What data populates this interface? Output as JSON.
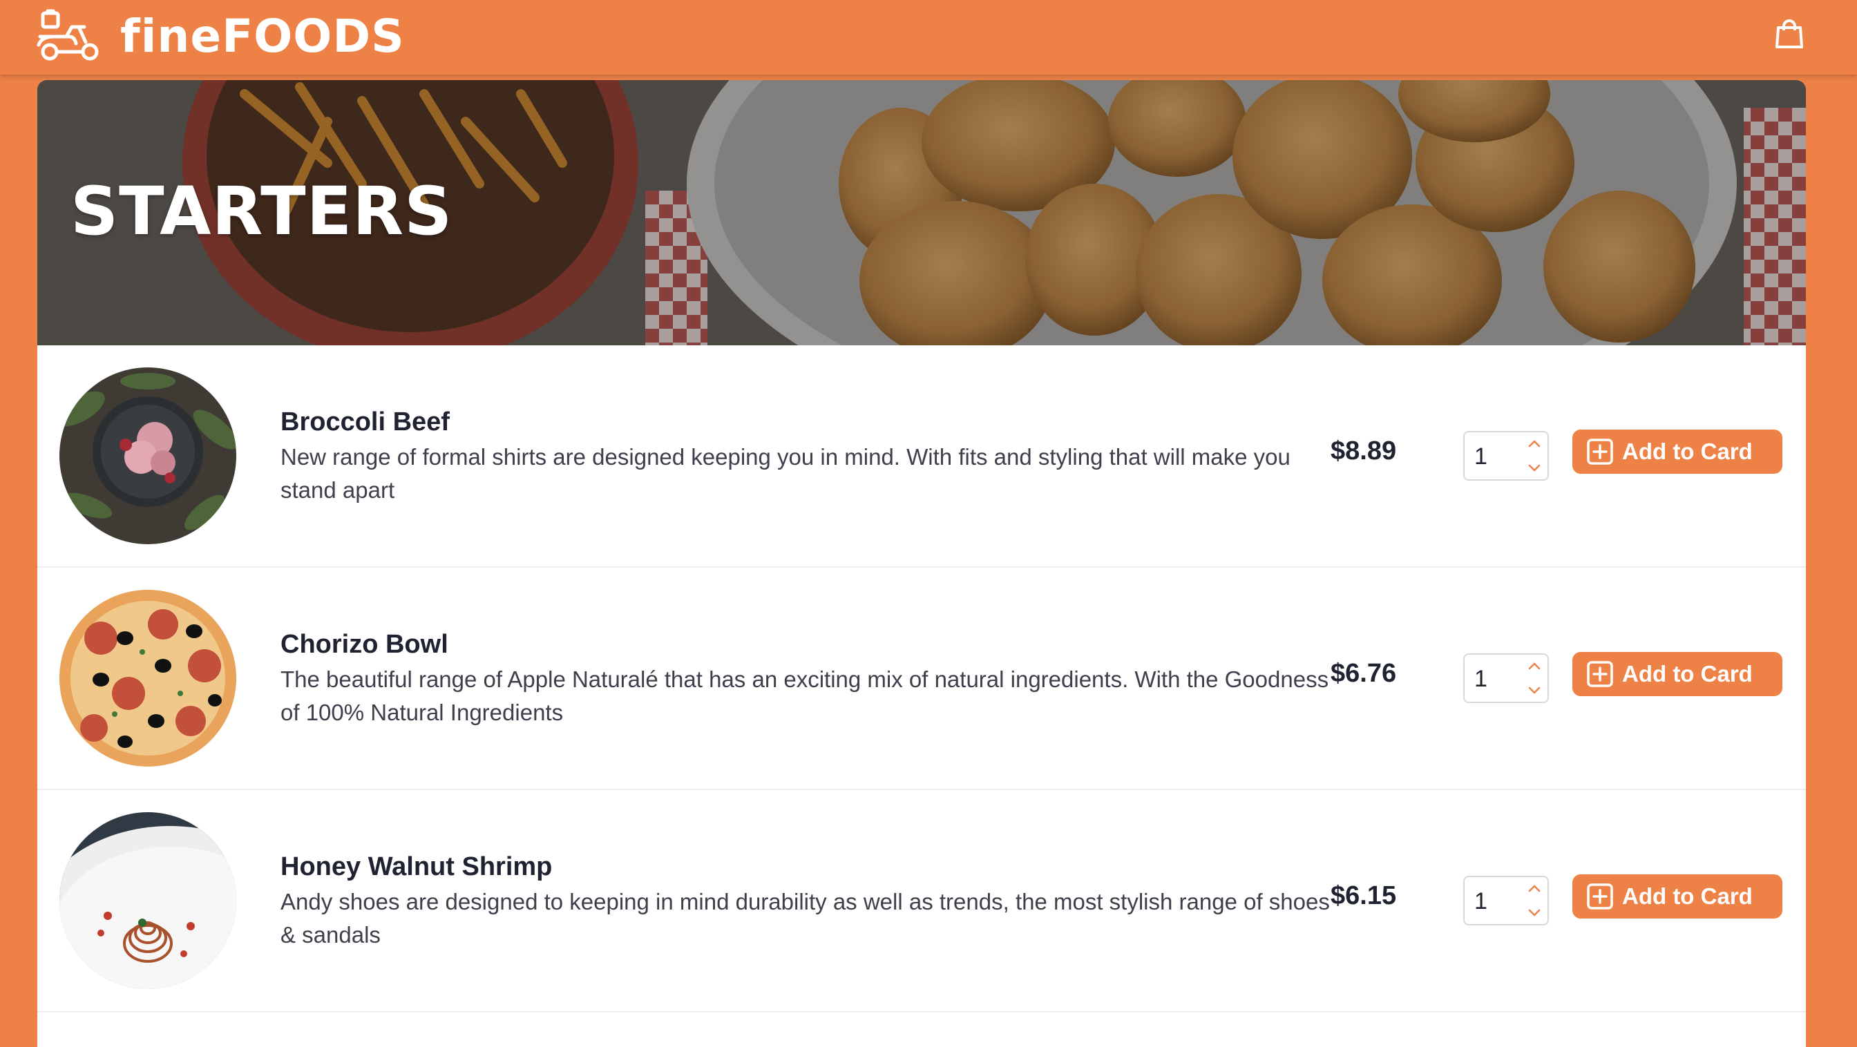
{
  "header": {
    "brand": "fineFOODS",
    "logo_icon": "scooter-delivery-icon",
    "cart_icon": "shopping-bag-icon"
  },
  "hero": {
    "title": "STARTERS"
  },
  "colors": {
    "accent": "#ee8146",
    "text_dark": "#1f2230",
    "text_body": "#3d3f4a"
  },
  "items": [
    {
      "name": "Broccoli Beef",
      "description": "New range of formal shirts are designed keeping you in mind. With fits and styling that will make you stand apart",
      "price": "$8.89",
      "quantity": "1",
      "button_label": "Add to Card"
    },
    {
      "name": "Chorizo Bowl",
      "description": "The beautiful range of Apple Naturalé that has an exciting mix of natural ingredients. With the Goodness of 100% Natural Ingredients",
      "price": "$6.76",
      "quantity": "1",
      "button_label": "Add to Card"
    },
    {
      "name": "Honey Walnut Shrimp",
      "description": "Andy shoes are designed to keeping in mind durability as well as trends, the most stylish range of shoes & sandals",
      "price": "$6.15",
      "quantity": "1",
      "button_label": "Add to Card"
    }
  ]
}
